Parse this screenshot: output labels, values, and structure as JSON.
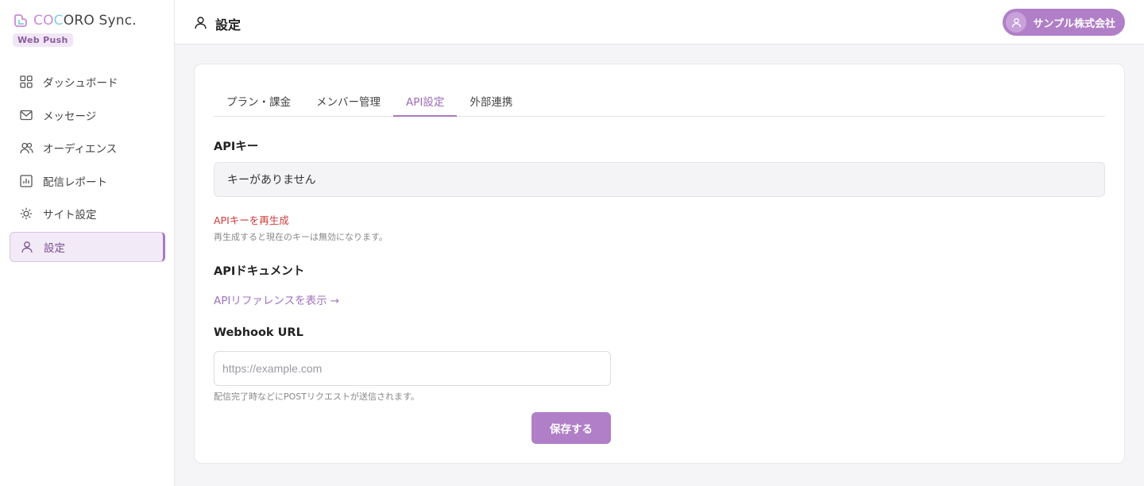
{
  "brand": {
    "name_part1": "CO",
    "name_part2": "C",
    "name_part3": "ORO Sync.",
    "badge": "Web Push"
  },
  "sidebar": {
    "items": [
      {
        "label": "ダッシュボード",
        "icon": "grid-icon"
      },
      {
        "label": "メッセージ",
        "icon": "mail-icon"
      },
      {
        "label": "オーディエンス",
        "icon": "users-icon"
      },
      {
        "label": "配信レポート",
        "icon": "chart-icon"
      },
      {
        "label": "サイト設定",
        "icon": "gear-icon"
      },
      {
        "label": "設定",
        "icon": "user-icon",
        "active": true
      }
    ]
  },
  "header": {
    "title": "設定",
    "company": "サンプル株式会社"
  },
  "tabs": [
    {
      "label": "プラン・課金"
    },
    {
      "label": "メンバー管理"
    },
    {
      "label": "API設定",
      "active": true
    },
    {
      "label": "外部連携"
    }
  ],
  "api": {
    "key_label": "APIキー",
    "key_value": "キーがありません",
    "regenerate_label": "APIキーを再生成",
    "regenerate_help": "再生成すると現在のキーは無効になります。",
    "docs_label": "APIドキュメント",
    "docs_link": "APIリファレンスを表示 →"
  },
  "webhook": {
    "label": "Webhook URL",
    "value": "",
    "placeholder": "https://example.com",
    "help": "配信完了時などにPOSTリクエストが送信されます。",
    "save_label": "保存する"
  },
  "colors": {
    "accent": "#b07fc7",
    "accent_text": "#9b6bb5",
    "danger": "#d03a3a",
    "active_bg": "#f3eaf7"
  }
}
